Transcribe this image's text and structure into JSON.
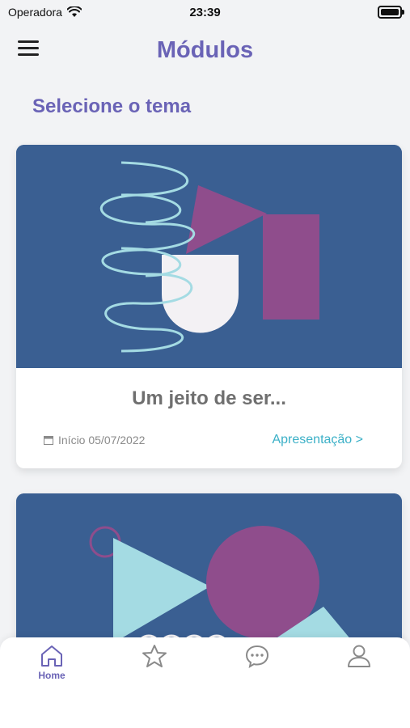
{
  "status": {
    "carrier": "Operadora",
    "time": "23:39",
    "battery_level": 1.0
  },
  "header": {
    "title": "Módulos"
  },
  "main": {
    "section_title": "Selecione o tema"
  },
  "cards": [
    {
      "title": "Um jeito de ser...",
      "date": "Início 05/07/2022",
      "link": "Apresentação >"
    }
  ],
  "tabs": [
    {
      "label": "Home",
      "icon": "home-icon",
      "active": true
    },
    {
      "label": "",
      "icon": "star-icon",
      "active": false
    },
    {
      "label": "",
      "icon": "chat-icon",
      "active": false
    },
    {
      "label": "",
      "icon": "user-icon",
      "active": false
    }
  ],
  "colors": {
    "accent": "#6a63b6",
    "card_bg": "#3a5f92",
    "purple_shape": "#8f4d8c",
    "light_blue": "#a4dbe3",
    "link": "#3bb0c7"
  }
}
